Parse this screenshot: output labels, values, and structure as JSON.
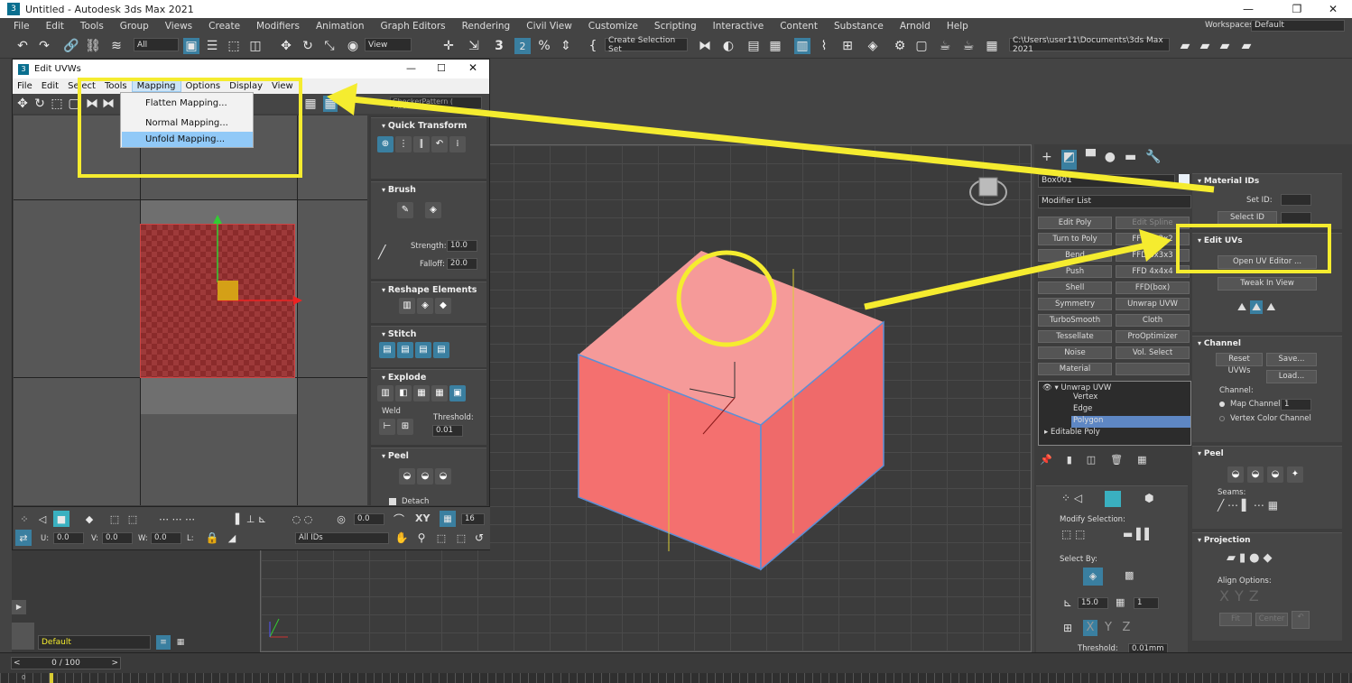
{
  "app": {
    "title": "Untitled - Autodesk 3ds Max 2021",
    "logo_label": "3"
  },
  "main_menu": [
    "File",
    "Edit",
    "Tools",
    "Group",
    "Views",
    "Create",
    "Modifiers",
    "Animation",
    "Graph Editors",
    "Rendering",
    "Civil View",
    "Customize",
    "Scripting",
    "Interactive",
    "Content",
    "Substance",
    "Arnold",
    "Help"
  ],
  "workspace": {
    "label": "Workspaces:",
    "value": "Default"
  },
  "toolbar": {
    "filter": "All",
    "view": "View",
    "selection_set": "Create Selection Set",
    "project_path": "C:\\Users\\user11\\Documents\\3ds Max 2021",
    "snap_label": "3",
    "snap_label_2": "2"
  },
  "uv_editor": {
    "title": "Edit UVWs",
    "menus": [
      "File",
      "Edit",
      "Select",
      "Tools",
      "Mapping",
      "Options",
      "Display",
      "View"
    ],
    "active_menu": "Mapping",
    "checker_dropdown": "CheckerPattern ( Checker )",
    "mapping_dropdown": [
      "Flatten Mapping...",
      "Normal Mapping...",
      "Unfold Mapping..."
    ],
    "panels": {
      "quick_transform": "Quick Transform",
      "brush": "Brush",
      "strength_label": "Strength:",
      "strength": "10.0",
      "falloff_label": "Falloff:",
      "falloff": "20.0",
      "reshape": "Reshape Elements",
      "stitch": "Stitch",
      "explode": "Explode",
      "weld": "Weld",
      "threshold_label": "Threshold:",
      "threshold": "0.01",
      "peel": "Peel",
      "detach": "Detach"
    },
    "bottom": {
      "value_a": "0.0",
      "xy": "XY",
      "value_b": "16",
      "u_label": "U:",
      "u": "0.0",
      "v_label": "V:",
      "v": "0.0",
      "w_label": "W:",
      "w": "0.0",
      "l_label": "L:",
      "ids": "All IDs"
    }
  },
  "command_panel": {
    "object_name": "Box001",
    "modifier_list": "Modifier List",
    "modifier_buttons": [
      "Edit Poly",
      "Edit Spline",
      "Turn to Poly",
      "FFD 2x2x2",
      "Bend",
      "FFD 3x3x3",
      "Push",
      "FFD 4x4x4",
      "Shell",
      "FFD(box)",
      "Symmetry",
      "Unwrap UVW",
      "TurboSmooth",
      "Cloth",
      "Tessellate",
      "ProOptimizer",
      "Noise",
      "Vol. Select",
      "Material",
      ""
    ],
    "stack": {
      "top": "Unwrap UVW",
      "subs": [
        "Vertex",
        "Edge",
        "Polygon"
      ],
      "selected_sub": "Polygon",
      "base": "Editable Poly"
    },
    "lower": {
      "modify_selection": "Modify Selection:",
      "select_by": "Select By:",
      "angle": "15.0",
      "count": "1",
      "threshold_label": "Threshold:",
      "threshold": "0.01mm",
      "xyz": [
        "X",
        "Y",
        "Z"
      ]
    }
  },
  "rollouts": {
    "material_ids": {
      "title": "Material IDs",
      "set_id": "Set ID:",
      "select_id": "Select ID"
    },
    "edit_uvs": {
      "title": "Edit UVs",
      "open": "Open UV Editor ...",
      "tweak": "Tweak In View"
    },
    "channel": {
      "title": "Channel",
      "reset": "Reset UVWs",
      "save": "Save...",
      "load": "Load...",
      "channel_label": "Channel:",
      "map_channel": "Map Channel:",
      "map_value": "1",
      "vertex_color": "Vertex Color Channel"
    },
    "peel": {
      "title": "Peel",
      "seams": "Seams:"
    },
    "projection": {
      "title": "Projection",
      "align": "Align Options:",
      "xyz": [
        "X",
        "Y",
        "Z"
      ],
      "fit": "Fit",
      "center": "Center"
    }
  },
  "bottom_bar": {
    "layer": "Default",
    "frame": "0 / 100",
    "timeline_zero": "0"
  },
  "highlight_color": "#f5ec2f",
  "cube_color": "#f4706f"
}
